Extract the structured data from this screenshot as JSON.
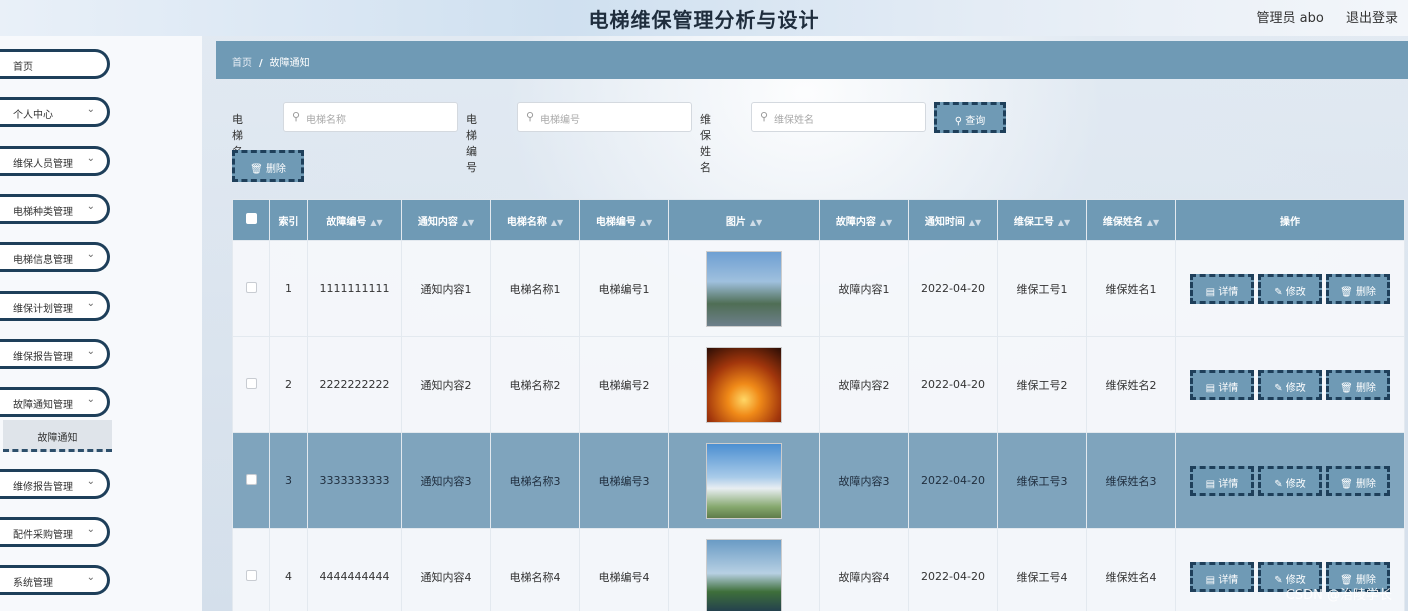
{
  "header": {
    "title": "电梯维保管理分析与设计",
    "user": "管理员 abo",
    "logout": "退出登录"
  },
  "sidebar": {
    "items": [
      {
        "label": "首页",
        "chevron": false
      },
      {
        "label": "个人中心",
        "chevron": true
      },
      {
        "label": "维保人员管理",
        "chevron": true
      },
      {
        "label": "电梯种类管理",
        "chevron": true
      },
      {
        "label": "电梯信息管理",
        "chevron": true
      },
      {
        "label": "维保计划管理",
        "chevron": true
      },
      {
        "label": "维保报告管理",
        "chevron": true
      },
      {
        "label": "故障通知管理",
        "chevron": true
      },
      {
        "label": "维修报告管理",
        "chevron": true
      },
      {
        "label": "配件采购管理",
        "chevron": true
      },
      {
        "label": "系统管理",
        "chevron": true
      }
    ],
    "submenu": "故障通知"
  },
  "breadcrumb": {
    "home": "首页",
    "separator": "/",
    "current": "故障通知"
  },
  "search": {
    "fields": [
      {
        "label": "电梯名称",
        "placeholder": "电梯名称"
      },
      {
        "label": "电梯编号",
        "placeholder": "电梯编号"
      },
      {
        "label": "维保姓名",
        "placeholder": "维保姓名"
      }
    ],
    "query_button": "查询"
  },
  "toolbar": {
    "delete_button": "删除"
  },
  "table": {
    "columns": [
      "索引",
      "故障编号",
      "通知内容",
      "电梯名称",
      "电梯编号",
      "图片",
      "故障内容",
      "通知时间",
      "维保工号",
      "维保姓名",
      "操作"
    ],
    "rows": [
      {
        "index": "1",
        "fault_no": "1111111111",
        "notice": "通知内容1",
        "name": "电梯名称1",
        "code": "电梯编号1",
        "image": "power-tower-image",
        "fault": "故障内容1",
        "time": "2022-04-20",
        "staff_no": "维保工号1",
        "staff_name": "维保姓名1"
      },
      {
        "index": "2",
        "fault_no": "2222222222",
        "notice": "通知内容2",
        "name": "电梯名称2",
        "code": "电梯编号2",
        "image": "sunset-pylons-image",
        "fault": "故障内容2",
        "time": "2022-04-20",
        "staff_no": "维保工号2",
        "staff_name": "维保姓名2"
      },
      {
        "index": "3",
        "fault_no": "3333333333",
        "notice": "通知内容3",
        "name": "电梯名称3",
        "code": "电梯编号3",
        "image": "power-plant-image",
        "fault": "故障内容3",
        "time": "2022-04-20",
        "staff_no": "维保工号3",
        "staff_name": "维保姓名3"
      },
      {
        "index": "4",
        "fault_no": "4444444444",
        "notice": "通知内容4",
        "name": "电梯名称4",
        "code": "电梯编号4",
        "image": "substation-image",
        "fault": "故障内容4",
        "time": "2022-04-20",
        "staff_no": "维保工号4",
        "staff_name": "维保姓名4"
      }
    ],
    "actions": {
      "detail": "详情",
      "edit": "修改",
      "delete": "删除"
    }
  },
  "watermark": "CSDN @治陵学长",
  "colors": {
    "accent": "#6f9ab5",
    "dark_border": "#1e3f5a"
  }
}
